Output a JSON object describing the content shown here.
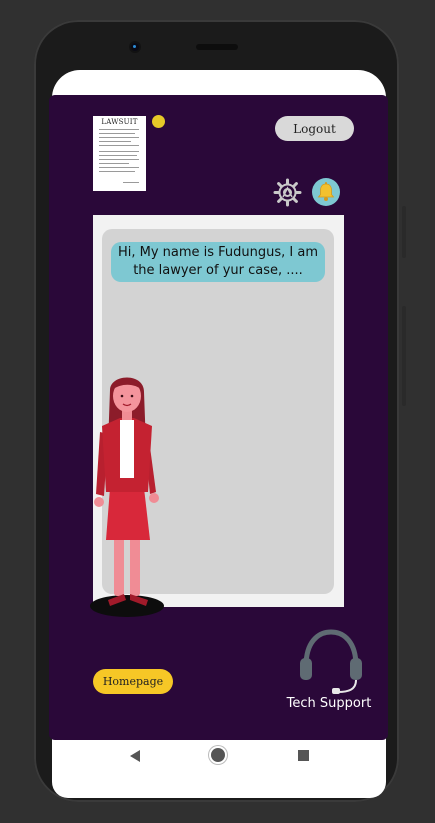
{
  "document": {
    "title": "LAWSUIT"
  },
  "header": {
    "logout_label": "Logout"
  },
  "icons": {
    "settings": "gear-icon",
    "notifications": "bell-icon",
    "support": "headset-icon"
  },
  "chat": {
    "message": "Hi, My name is Fudungus, I am the lawyer of yur case, ...."
  },
  "footer": {
    "homepage_label": "Homepage",
    "support_label": "Tech Support"
  },
  "colors": {
    "app_background": "#2a0839",
    "accent_yellow": "#f6c726",
    "bubble": "#7ec8d2",
    "logout_button": "#d9d9d9"
  }
}
